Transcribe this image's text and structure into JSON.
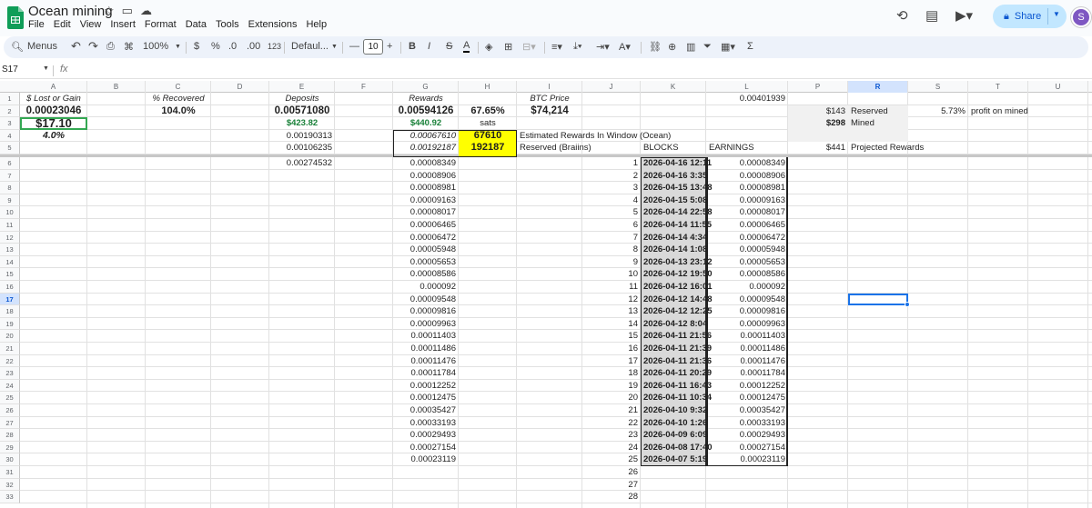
{
  "app": {
    "title": "Ocean mining",
    "menu": [
      "File",
      "Edit",
      "View",
      "Insert",
      "Format",
      "Data",
      "Tools",
      "Extensions",
      "Help"
    ],
    "share_label": "Share",
    "avatar_letter": "S"
  },
  "toolbar": {
    "menus": "Menus",
    "zoom": "100%",
    "currency": "$",
    "percent": "%",
    "dec_down": ".0",
    "dec_up": ".00",
    "number_format": "123",
    "font": "Defaul...",
    "font_size": "10",
    "minus": "—",
    "plus": "+",
    "bold": "B",
    "italic": "I",
    "strike": "S",
    "textcolor": "A",
    "sigma": "Σ"
  },
  "formula": {
    "name_box": "S17",
    "fx": "fx",
    "content": ""
  },
  "columns": [
    "A",
    "B",
    "C",
    "D",
    "E",
    "F",
    "G",
    "H",
    "I",
    "J",
    "K",
    "L",
    "P",
    "R",
    "S",
    "T",
    "U"
  ],
  "rows": [
    "1",
    "2",
    "3",
    "4",
    "5",
    "6",
    "7",
    "8",
    "9",
    "10",
    "11",
    "12",
    "13",
    "14",
    "15",
    "16",
    "17",
    "18",
    "19",
    "20",
    "21",
    "22",
    "23",
    "24",
    "25",
    "26",
    "27",
    "28",
    "29",
    "30",
    "31",
    "32",
    "33"
  ],
  "header": {
    "a1": "$ Lost or Gain",
    "c1": "% Recovered",
    "e1": "Deposits",
    "g1": "Rewards",
    "i1": "BTC Price",
    "p1": "0.00401939"
  },
  "row2": {
    "a": "0.00023046",
    "c": "104.0%",
    "e": "0.00571080",
    "g": "0.00594126",
    "h": "67.65%",
    "i": "$74,214",
    "r": "$143",
    "s": "Reserved",
    "t": "5.73%",
    "u": "profit on mined"
  },
  "row3": {
    "a": "$17.10",
    "e": "$423.82",
    "g": "$440.92",
    "h": "sats",
    "r": "$298",
    "s": "Mined"
  },
  "row4": {
    "a": "4.0%",
    "e": "0.00190313",
    "g": "0.00067610",
    "h": "67610",
    "i": "Estimated Rewards In Window (Ocean)"
  },
  "row5": {
    "e": "0.00106235",
    "g": "0.00192187",
    "h": "192187",
    "i": "Reserved (Braiins)",
    "l": "BLOCKS",
    "p": "EARNINGS",
    "r": "$441",
    "s": "Projected Rewards"
  },
  "row6": {
    "e": "0.00274532"
  },
  "rewards_col_g": [
    "0.00008349",
    "0.00008906",
    "0.00008981",
    "0.00009163",
    "0.00008017",
    "0.00006465",
    "0.00006472",
    "0.00005948",
    "0.00005653",
    "0.00008586",
    "0.000092",
    "0.00009548",
    "0.00009816",
    "0.00009963",
    "0.00011403",
    "0.00011486",
    "0.00011476",
    "0.00011784",
    "0.00012252",
    "0.00012475",
    "0.00035427",
    "0.00033193",
    "0.00029493",
    "0.00027154",
    "0.00023119"
  ],
  "block_nums": [
    "1",
    "2",
    "3",
    "4",
    "5",
    "6",
    "7",
    "8",
    "9",
    "10",
    "11",
    "12",
    "13",
    "14",
    "15",
    "16",
    "17",
    "18",
    "19",
    "20",
    "21",
    "22",
    "23",
    "24",
    "25",
    "26",
    "27",
    "28"
  ],
  "block_dates": [
    "2026-04-16 12:11",
    "2026-04-16 3:35",
    "2026-04-15 13:48",
    "2026-04-15 5:08",
    "2026-04-14 22:58",
    "2026-04-14 11:55",
    "2026-04-14 4:34",
    "2026-04-14 1:08",
    "2026-04-13 23:12",
    "2026-04-12 19:50",
    "2026-04-12 16:01",
    "2026-04-12 14:48",
    "2026-04-12 12:25",
    "2026-04-12 8:04",
    "2026-04-11 21:56",
    "2026-04-11 21:39",
    "2026-04-11 21:36",
    "2026-04-11 20:29",
    "2026-04-11 16:43",
    "2026-04-11 10:34",
    "2026-04-10 9:32",
    "2026-04-10 1:26",
    "2026-04-09 6:09",
    "2026-04-08 17:40",
    "2026-04-07 5:19"
  ],
  "earnings_col_p": [
    "0.00008349",
    "0.00008906",
    "0.00008981",
    "0.00009163",
    "0.00008017",
    "0.00006465",
    "0.00006472",
    "0.00005948",
    "0.00005653",
    "0.00008586",
    "0.000092",
    "0.00009548",
    "0.00009816",
    "0.00009963",
    "0.00011403",
    "0.00011486",
    "0.00011476",
    "0.00011784",
    "0.00012252",
    "0.00012475",
    "0.00035427",
    "0.00033193",
    "0.00029493",
    "0.00027154",
    "0.00023119"
  ],
  "colors": {
    "green_text": "#188038",
    "yellow": "#ffff00",
    "selection": "#1a73e8"
  }
}
